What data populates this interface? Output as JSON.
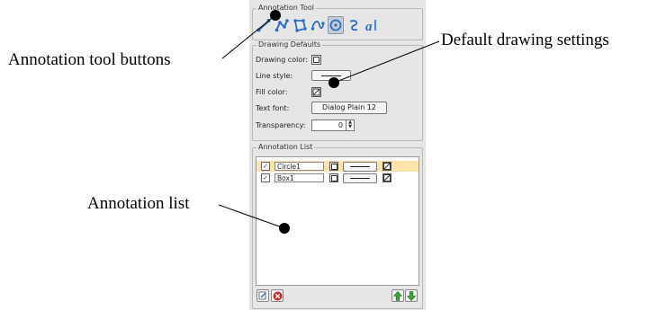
{
  "callouts": {
    "tools": "Annotation tool buttons",
    "defaults": "Default drawing settings",
    "list": "Annotation list"
  },
  "tool_group": {
    "title": "Annotation Tool",
    "tools": [
      "line-tool-icon",
      "polyline-tool-icon",
      "polygon-tool-icon",
      "path-tool-icon",
      "ellipse-tool-icon",
      "freehand-tool-icon",
      "text-tool-icon"
    ],
    "active_tool": "ellipse-tool-icon"
  },
  "defaults": {
    "title": "Drawing Defaults",
    "drawing_color_label": "Drawing color:",
    "line_style_label": "Line style:",
    "fill_color_label": "Fill color:",
    "text_font_label": "Text font:",
    "text_font_value": "Dialog Plain 12",
    "transparency_label": "Transparency:",
    "transparency_value": "0"
  },
  "list": {
    "title": "Annotation List",
    "rows": [
      {
        "name": "Circle1",
        "visible": true,
        "selected": true
      },
      {
        "name": "Box1",
        "visible": true,
        "selected": false
      }
    ]
  },
  "colors": {
    "panel_bg": "#e6e6e6",
    "selected_row": "#ffe3a8",
    "icon_blue": "#2a6fc0",
    "delete_red": "#d42a2a",
    "arrow_green": "#3aa63a"
  }
}
